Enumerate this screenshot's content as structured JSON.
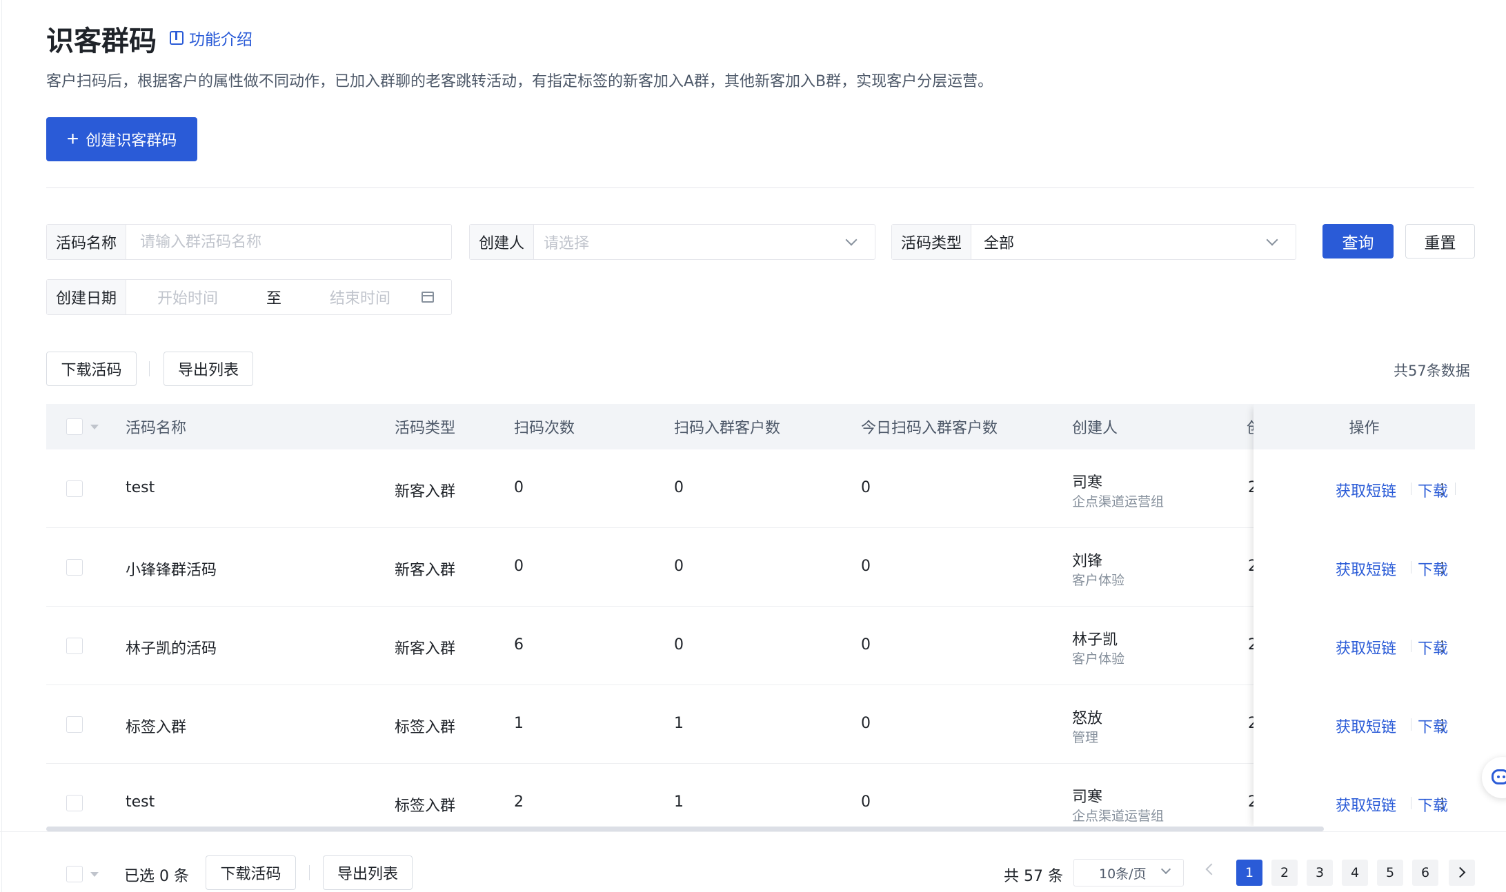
{
  "header": {
    "title": "识客群码",
    "intro_link": "功能介绍",
    "description": "客户扫码后，根据客户的属性做不同动作，已加入群聊的老客跳转活动，有指定标签的新客加入A群，其他新客加入B群，实现客户分层运营。",
    "create_button": "创建识客群码"
  },
  "filters": {
    "name_label": "活码名称",
    "name_placeholder": "请输入群活码名称",
    "creator_label": "创建人",
    "creator_placeholder": "请选择",
    "type_label": "活码类型",
    "type_value": "全部",
    "date_label": "创建日期",
    "date_start": "开始时间",
    "date_sep": "至",
    "date_end": "结束时间",
    "query_button": "查询",
    "reset_button": "重置"
  },
  "toolbar": {
    "download_button": "下载活码",
    "export_button": "导出列表",
    "total_text": "共57条数据"
  },
  "table": {
    "columns": {
      "name": "活码名称",
      "type": "活码类型",
      "scans": "扫码次数",
      "joined": "扫码入群客户数",
      "today_joined": "今日扫码入群客户数",
      "creator": "创建人",
      "created_partial": "创",
      "ops": "操作"
    },
    "rows": [
      {
        "name": "test",
        "type": "新客入群",
        "scans": "0",
        "joined": "0",
        "today": "0",
        "creator": "司寒",
        "dept": "企点渠道运营组",
        "date_partial": "2"
      },
      {
        "name": "小锋锋群活码",
        "type": "新客入群",
        "scans": "0",
        "joined": "0",
        "today": "0",
        "creator": "刘锋",
        "dept": "客户体验",
        "date_partial": "2"
      },
      {
        "name": "林子凯的活码",
        "type": "新客入群",
        "scans": "6",
        "joined": "0",
        "today": "0",
        "creator": "林子凯",
        "dept": "客户体验",
        "date_partial": "2"
      },
      {
        "name": "标签入群",
        "type": "标签入群",
        "scans": "1",
        "joined": "1",
        "today": "0",
        "creator": "怒放",
        "dept": "管理",
        "date_partial": "2"
      },
      {
        "name": "test",
        "type": "标签入群",
        "scans": "2",
        "joined": "1",
        "today": "0",
        "creator": "司寒",
        "dept": "企点渠道运营组",
        "date_partial": "2"
      }
    ],
    "op_link": "获取短链",
    "op_download": "下载"
  },
  "footer": {
    "selected": "已选 0 条",
    "download_button": "下载活码",
    "export_button": "导出列表",
    "total": "共 57 条",
    "page_size": "10条/页",
    "pages": [
      "1",
      "2",
      "3",
      "4",
      "5",
      "6"
    ],
    "current_page": "1"
  },
  "colors": {
    "primary": "#2a5bd7",
    "header_bg": "#f2f4f7",
    "muted_text": "#86909c"
  }
}
